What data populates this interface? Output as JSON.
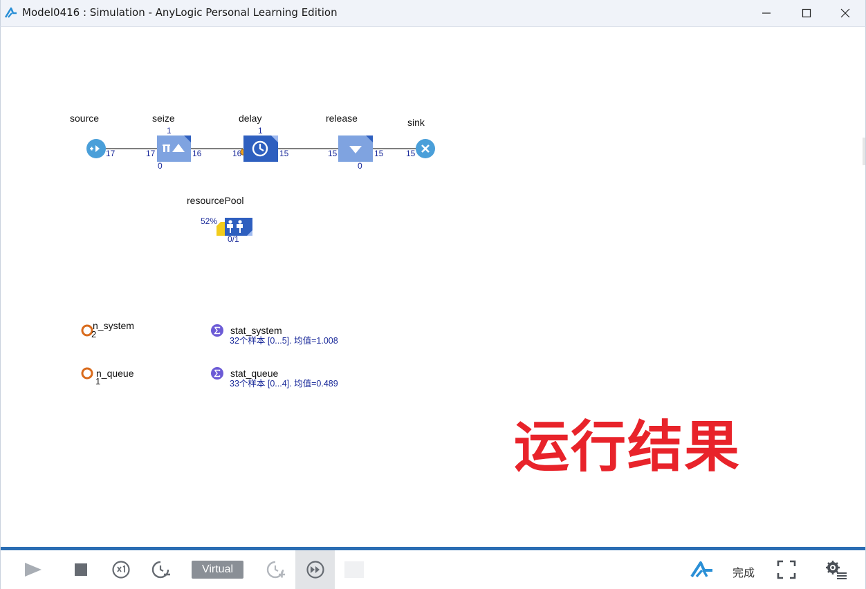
{
  "window": {
    "title": "Model0416 : Simulation - AnyLogic Personal Learning Edition"
  },
  "blocks": {
    "source": {
      "label": "source",
      "out": "17"
    },
    "seize": {
      "label": "seize",
      "top": "1",
      "in": "17",
      "out": "16",
      "bottom": "0"
    },
    "delay": {
      "label": "delay",
      "top": "1",
      "in": "16",
      "out": "15"
    },
    "release": {
      "label": "release",
      "in": "15",
      "out": "15",
      "bottom": "0"
    },
    "sink": {
      "label": "sink",
      "in": "15"
    },
    "resourcePool": {
      "label": "resourcePool",
      "utilization": "52%",
      "count": "0/1"
    }
  },
  "variables": [
    {
      "name": "n_system",
      "value": "2"
    },
    {
      "name": "n_queue",
      "value": "1"
    }
  ],
  "statistics": [
    {
      "name": "stat_system",
      "summary": "32个样本 [0...5]. 均值=1.008"
    },
    {
      "name": "stat_queue",
      "summary": "33个样本 [0...4]. 均值=0.489"
    }
  ],
  "overlay": {
    "text": "运行结果"
  },
  "toolbar": {
    "virtual_label": "Virtual",
    "status": "完成"
  },
  "colors": {
    "accent": "#2a6db3",
    "block": "#5b86d6",
    "block_dark": "#2e5fbf",
    "counter": "#1a2a9a",
    "overlay": "#e8232a",
    "variable": "#d96b1c",
    "statistic": "#6c5bd6"
  }
}
